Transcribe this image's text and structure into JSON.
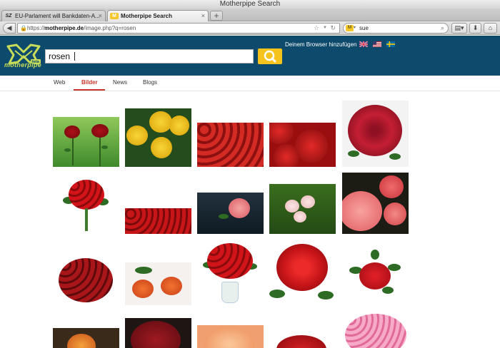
{
  "window": {
    "title": "Motherpipe Search"
  },
  "tabs": [
    {
      "favicon": "SZ",
      "label": "EU-Parlament will Bankdaten-A...",
      "close": "×"
    },
    {
      "favicon": "M",
      "label": "Motherpipe Search",
      "close": "×"
    }
  ],
  "newtab_label": "+",
  "nav": {
    "url_scheme": "https://",
    "url_host": "motherpipe.de",
    "url_path": "/image.php?q=rosen",
    "search_text": "sue"
  },
  "site": {
    "logo_text": "motherpipe",
    "query": "rosen",
    "add_browser": "Deinem Browser hinzufügen"
  },
  "verticals": [
    {
      "label": "Web"
    },
    {
      "label": "Bilder"
    },
    {
      "label": "News"
    },
    {
      "label": "Blogs"
    }
  ],
  "colors": {
    "header_bg": "#0d4a6b",
    "search_button": "#f6c21c",
    "accent": "#c7372a",
    "logo_green": "#c6dc5a"
  },
  "icons": [
    "back-arrow-icon",
    "lock-icon",
    "star-icon",
    "reload-icon",
    "search-icon",
    "download-icon",
    "home-icon"
  ]
}
